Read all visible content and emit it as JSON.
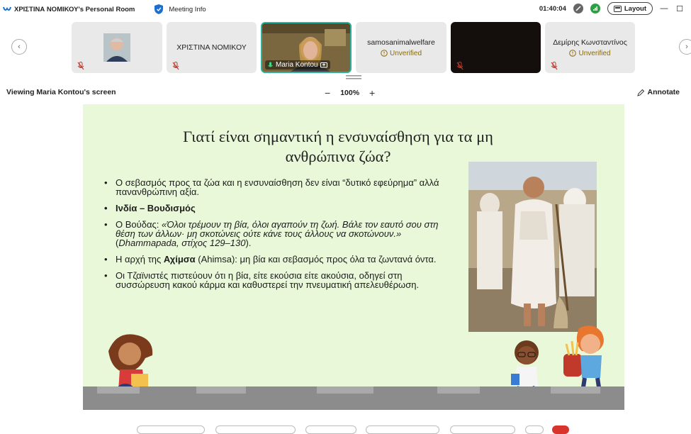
{
  "titlebar": {
    "room_title": "ΧΡΙΣΤΙΝΑ ΝΟΜΙΚΟΥ's Personal Room",
    "meeting_info": "Meeting Info",
    "timer": "01:40:04",
    "layout_label": "Layout",
    "minimize_icon": "minimize-icon",
    "maximize_icon": "maximize-icon"
  },
  "participants": [
    {
      "name": "",
      "type": "photo",
      "muted": true
    },
    {
      "name": "ΧΡΙΣΤΙΝΑ ΝΟΜΙΚΟΥ",
      "type": "name",
      "muted": true
    },
    {
      "name": "Maria Kontou",
      "type": "video",
      "active": true,
      "muted": false
    },
    {
      "name": "samosanimalwelfare",
      "status": "Unverified",
      "type": "name",
      "muted": false
    },
    {
      "name": "",
      "type": "dark",
      "muted": true
    },
    {
      "name": "Δεμίρης Κωνσταντίνος",
      "status": "Unverified",
      "type": "name",
      "muted": true
    }
  ],
  "viewbar": {
    "viewing_label": "Viewing Maria Kontou's screen",
    "zoom_minus": "−",
    "zoom_value": "100%",
    "zoom_plus": "+",
    "annotate_label": "Annotate"
  },
  "slide": {
    "title_line1": "Γιατί είναι σημαντική η ενσυναίσθηση για τα μη",
    "title_line2": "ανθρώπινα ζώα?",
    "bullet1": "Ο σεβασμός προς τα ζώα και η ενσυναίσθηση δεν είναι “δυτικό εφεύρημα” αλλά πανανθρώπινη αξία.",
    "bullet2": "Ινδία – Βουδισμός",
    "bullet3_prefix": "Ο Βούδας: ",
    "bullet3_quote": "«Όλοι τρέμουν τη βία, όλοι αγαπούν τη ζωή. Βάλε τον εαυτό σου στη θέση των άλλων· μη σκοτώνεις ούτε κάνε τους άλλους να σκοτώνουν.»",
    "bullet3_open": " (",
    "bullet3_source": "Dhammapada, στίχος 129–130",
    "bullet3_close": ").",
    "bullet4_prefix": "Η αρχή της ",
    "bullet4_bold": "Αχίμσα",
    "bullet4_suffix": " (Ahimsa): μη βία και σεβασμός προς όλα τα ζωντανά όντα.",
    "bullet5": "Οι Τζαϊνιστές πιστεύουν ότι η βία, είτε εκούσια είτε ακούσια, οδηγεί στη συσσώρευση κακού κάρμα και καθυστερεί την πνευματική απελευθέρωση."
  },
  "colors": {
    "slide_bg": "#e9f8d9",
    "active_tile_border": "#2bb3a0",
    "unverified": "#8a6a0a",
    "mute_red": "#c0392b"
  }
}
